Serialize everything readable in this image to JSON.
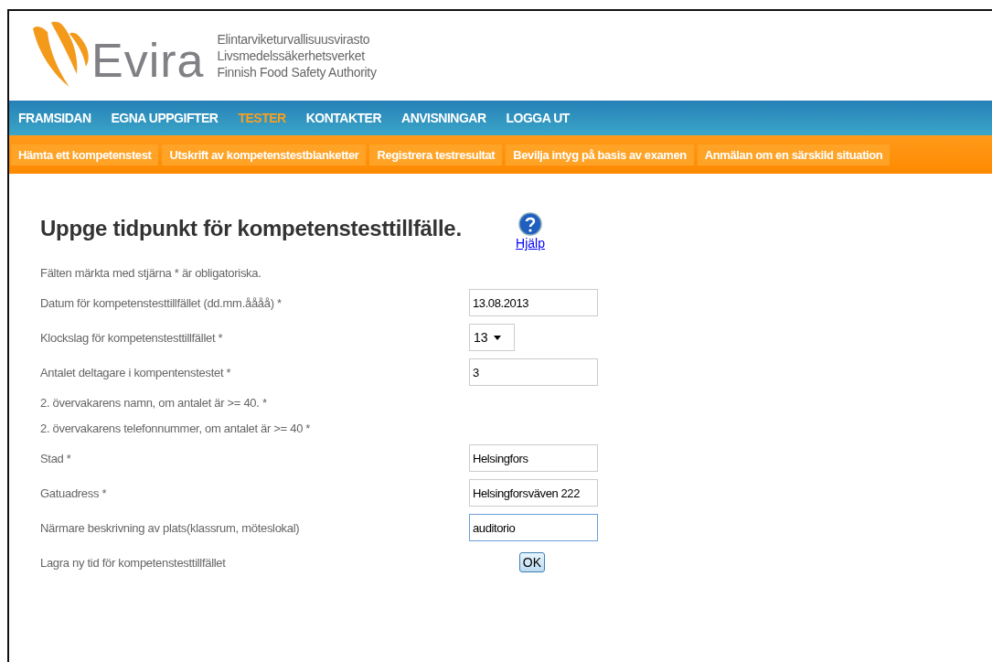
{
  "header": {
    "logo_text": "Evira",
    "agency_names": [
      "Elintarviketurvallisuusvirasto",
      "Livsmedelssäkerhetsverket",
      "Finnish Food Safety Authority"
    ]
  },
  "main_nav": [
    {
      "label": "FRAMSIDAN",
      "selected": false
    },
    {
      "label": "EGNA UPPGIFTER",
      "selected": false
    },
    {
      "label": "TESTER",
      "selected": true
    },
    {
      "label": "KONTAKTER",
      "selected": false
    },
    {
      "label": "ANVISNINGAR",
      "selected": false
    },
    {
      "label": "LOGGA UT",
      "selected": false
    }
  ],
  "sub_nav": [
    "Hämta ett kompetenstest",
    "Utskrift av kompetenstestblanketter",
    "Registrera testresultat",
    "Bevilja intyg på basis av examen",
    "Anmälan om en särskild situation"
  ],
  "title": "Uppge tidpunkt för kompetenstesttillfälle.",
  "help": {
    "label": "Hjälp"
  },
  "form": [
    {
      "kind": "note",
      "label": "Fälten märkta med stjärna * är obligatoriska."
    },
    {
      "kind": "text",
      "label": "Datum för kompetenstesttillfället (dd.mm.åååå) *",
      "value": "13.08.2013",
      "focused": false
    },
    {
      "kind": "select",
      "label": "Klockslag för kompetenstesttillfället *",
      "value": "13"
    },
    {
      "kind": "text",
      "label": "Antalet deltagare i kompentenstestet *",
      "value": "3",
      "focused": false
    },
    {
      "kind": "note",
      "label": "2. övervakarens namn, om antalet är >= 40. *"
    },
    {
      "kind": "note",
      "label": "2. övervakarens telefonnummer, om antalet är >= 40 *"
    },
    {
      "kind": "text",
      "label": "Stad *",
      "value": "Helsingfors",
      "focused": false
    },
    {
      "kind": "text",
      "label": "Gatuadress *",
      "value": "Helsingforsväven 222",
      "focused": false
    },
    {
      "kind": "text",
      "label": "Närmare beskrivning av plats(klassrum, möteslokal)",
      "value": "auditorio",
      "focused": true
    },
    {
      "kind": "button",
      "label": "Lagra ny tid för kompetenstesttillfället",
      "value": "OK"
    }
  ]
}
